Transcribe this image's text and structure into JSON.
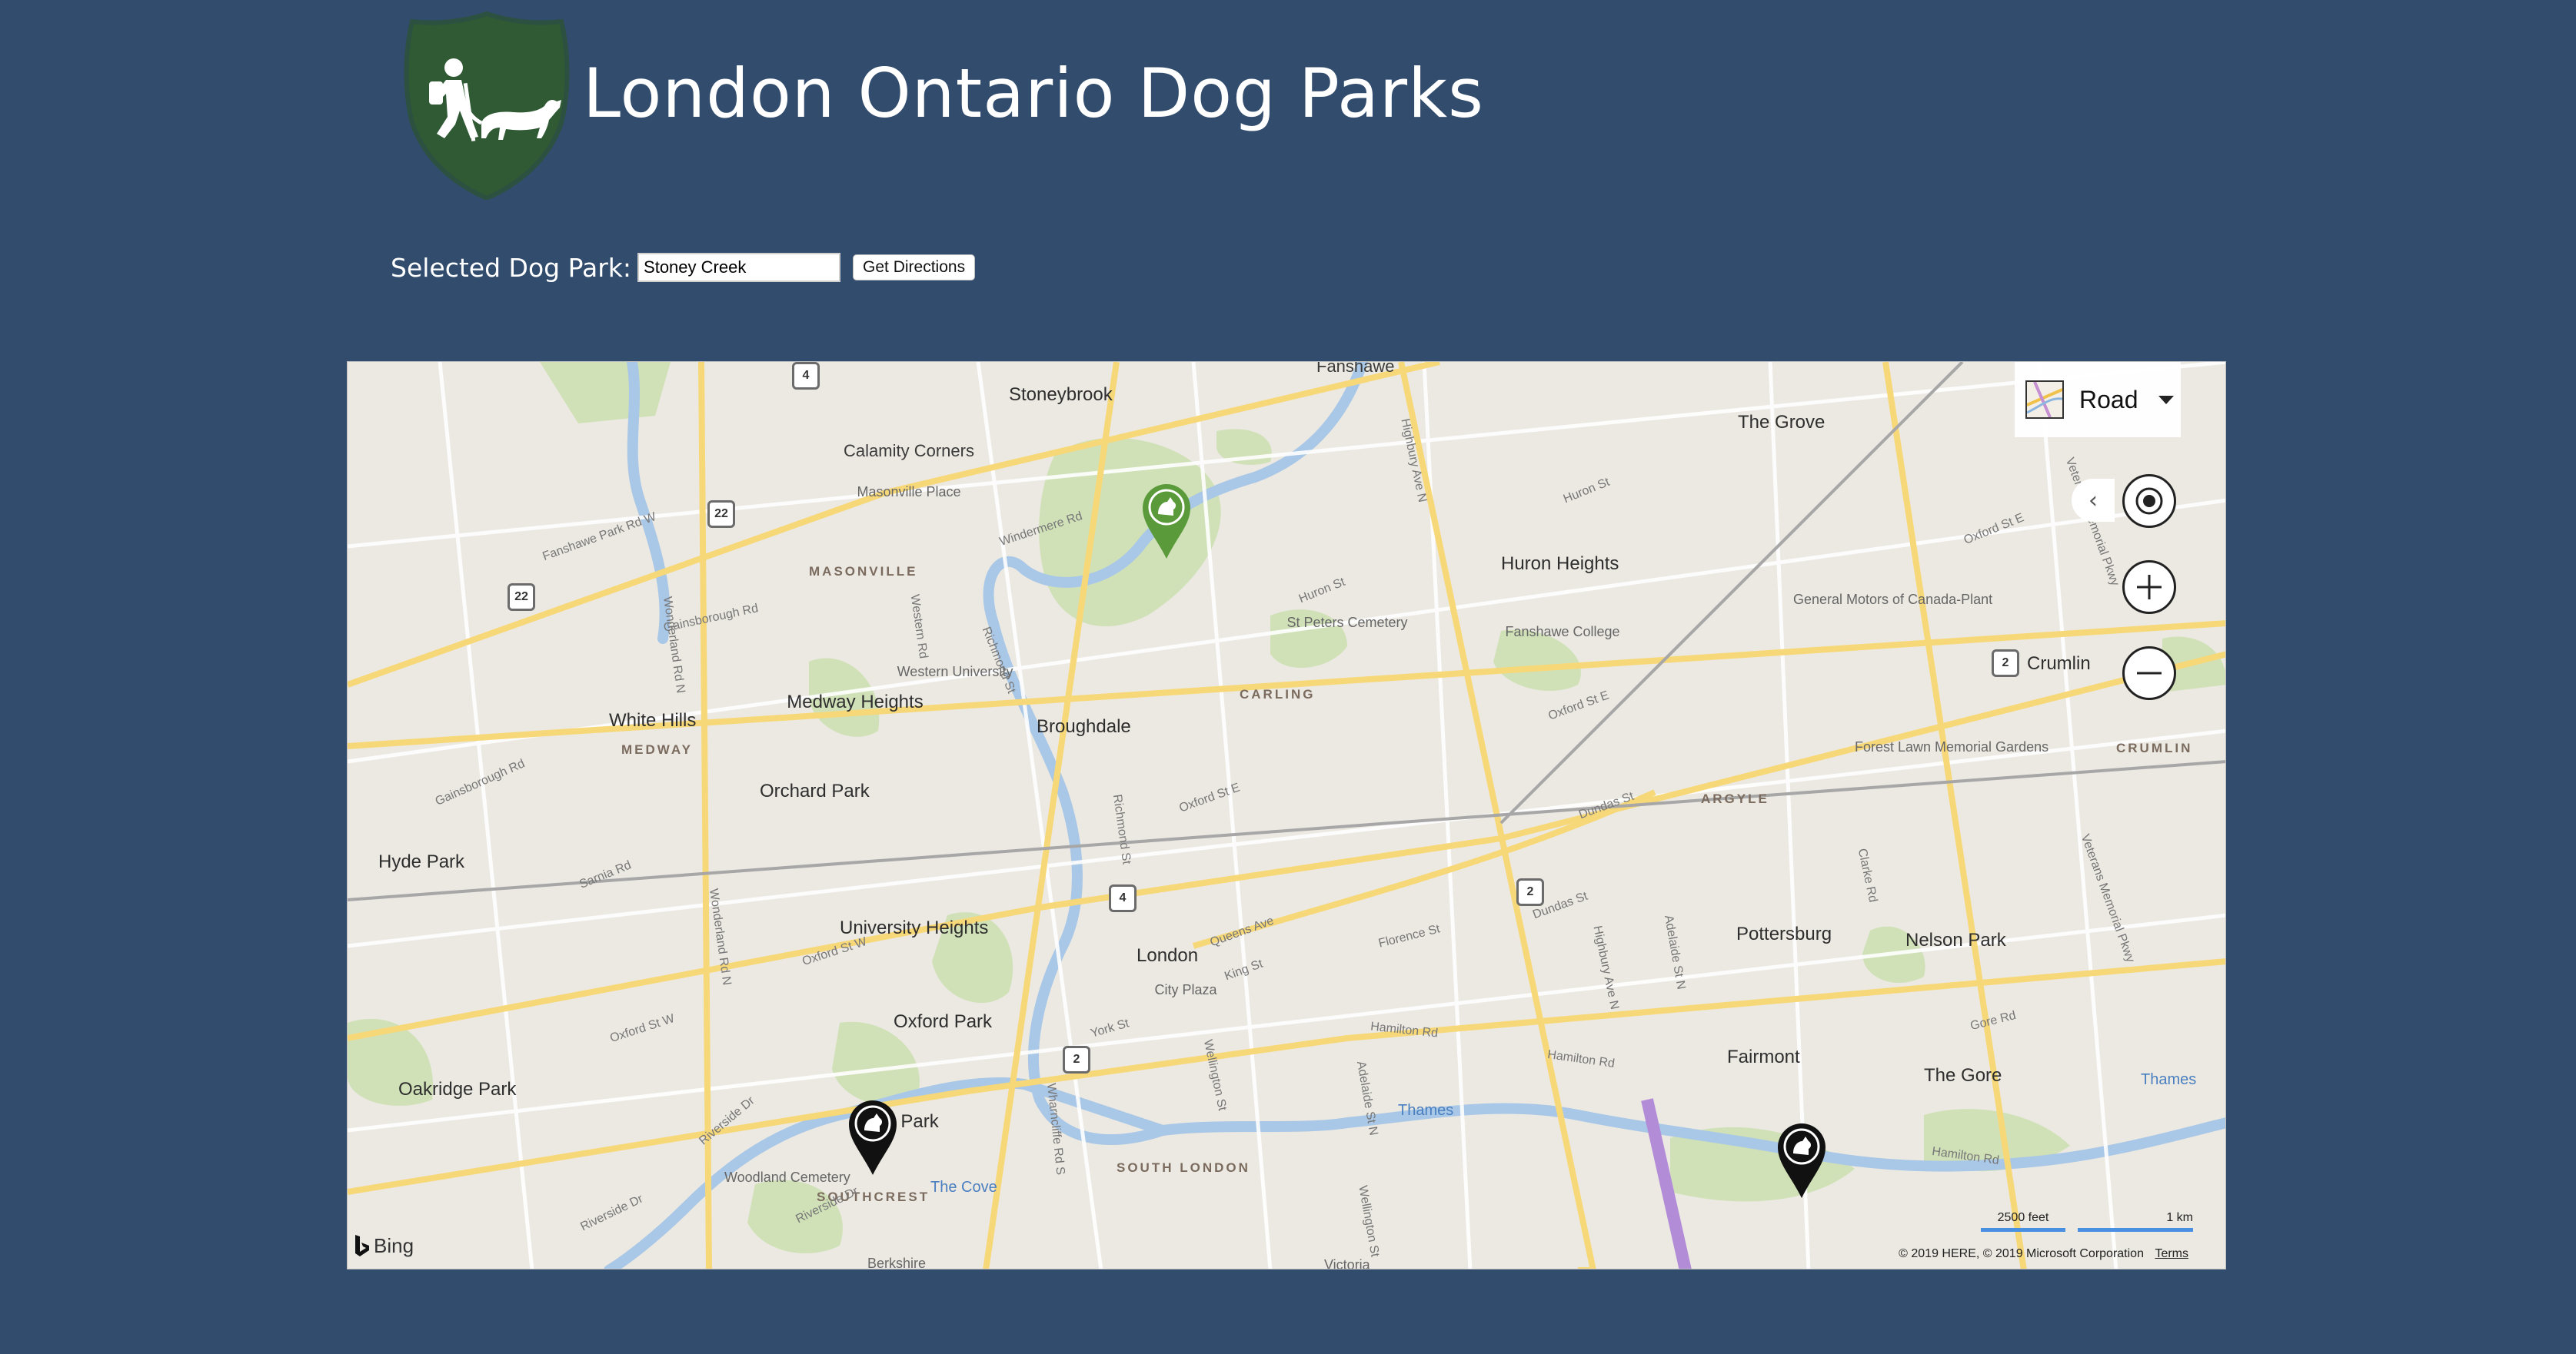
{
  "header": {
    "title": "London Ontario Dog Parks",
    "logo_icon": "hiker-and-dog-shield-icon"
  },
  "selector": {
    "label": "Selected Dog Park:",
    "input_value": "Stoney Creek",
    "button_label": "Get Directions"
  },
  "map": {
    "style_picker": {
      "label": "Road",
      "icon": "road-map-thumb-icon"
    },
    "controls": [
      "collapse-controls",
      "locate-me",
      "zoom-in",
      "zoom-out"
    ],
    "attribution": {
      "brand": "Bing",
      "copyright": "© 2019 HERE, © 2019 Microsoft Corporation",
      "terms": "Terms"
    },
    "scale": {
      "imperial": "2500 feet",
      "metric": "1 km"
    },
    "labels": {
      "fanshawe": "Fanshawe",
      "stoneybrook": "Stoneybrook",
      "calamity": "Calamity Corners",
      "masonville_place": "Masonville Place",
      "masonville": "MASONVILLE",
      "the_grove": "The Grove",
      "huron_heights": "Huron Heights",
      "st_peters": "St Peters Cemetery",
      "fanshawe_college": "Fanshawe College",
      "general_motors": "General Motors of Canada-Plant",
      "crumlin_road": "Crumlin",
      "crumlin_district": "CRUMLIN",
      "carling": "CARLING",
      "white_hills": "White Hills",
      "medway_heights": "Medway Heights",
      "medway": "MEDWAY",
      "western": "Western University",
      "broughdale": "Broughdale",
      "orchard_park": "Orchard Park",
      "forest_lawn": "Forest Lawn Memorial Gardens",
      "argyle": "ARGYLE",
      "hyde_park": "Hyde Park",
      "university_heights": "University Heights",
      "london": "London",
      "city_plaza": "City Plaza",
      "pottersburg": "Pottersburg",
      "nelson_park": "Nelson Park",
      "oxford_park": "Oxford Park",
      "fairmont": "Fairmont",
      "the_gore": "The Gore",
      "thames_east": "Thames",
      "oakridge": "Oakridge Park",
      "thames": "Thames",
      "al_park": "al Park",
      "woodland": "Woodland Cemetery",
      "southcrest": "SOUTHCREST",
      "the_cove": "The Cove",
      "south_london": "SOUTH LONDON",
      "berkshire": "Berkshire",
      "victoria": "Victoria",
      "fanshawe_park_rd": "Fanshawe Park Rd W",
      "richmond_st": "Richmond St",
      "richmond_st_2": "Richmond St",
      "highbury": "Highbury Ave N",
      "highbury_2": "Highbury Ave N",
      "dundas": "Dundas St",
      "florence": "Florence St",
      "york": "York St",
      "wellington": "Wellington St",
      "wharncliffe": "Wharncliffe Rd S",
      "oxford_e": "Oxford St E",
      "oxford_w": "Oxford St W",
      "hamilton": "Hamilton Rd",
      "windermere": "Windermere Rd",
      "huron_st": "Huron St",
      "sarnia": "Sarnia Rd",
      "wonderland": "Wonderland Rd N",
      "gainsborough": "Gainsborough Rd",
      "queens": "Queens Ave",
      "king": "King St",
      "clarke": "Clarke Rd",
      "veterans": "Veterans Memorial Pkwy",
      "adelaide": "Adelaide St N",
      "riverside": "Riverside Dr",
      "western_rd": "Western Rd",
      "gore_rd": "Gore Rd"
    },
    "shields": {
      "s4_top": "4",
      "s22_a": "22",
      "s22_b": "22",
      "s2_crumlin": "2",
      "s4_mid": "4",
      "s2_mid": "2",
      "s2_york": "2"
    },
    "pins": [
      {
        "name": "Stoney Creek",
        "selected": true,
        "color": "#5a9a3a"
      },
      {
        "name": "Southcrest dog park",
        "selected": false,
        "color": "#111111"
      },
      {
        "name": "East dog park",
        "selected": false,
        "color": "#111111"
      }
    ]
  },
  "colors": {
    "page_bg": "#324c6d",
    "logo_green": "#2f5a34",
    "water": "#a9c7e6",
    "park": "#cfe0b5",
    "road": "#f7d879"
  }
}
